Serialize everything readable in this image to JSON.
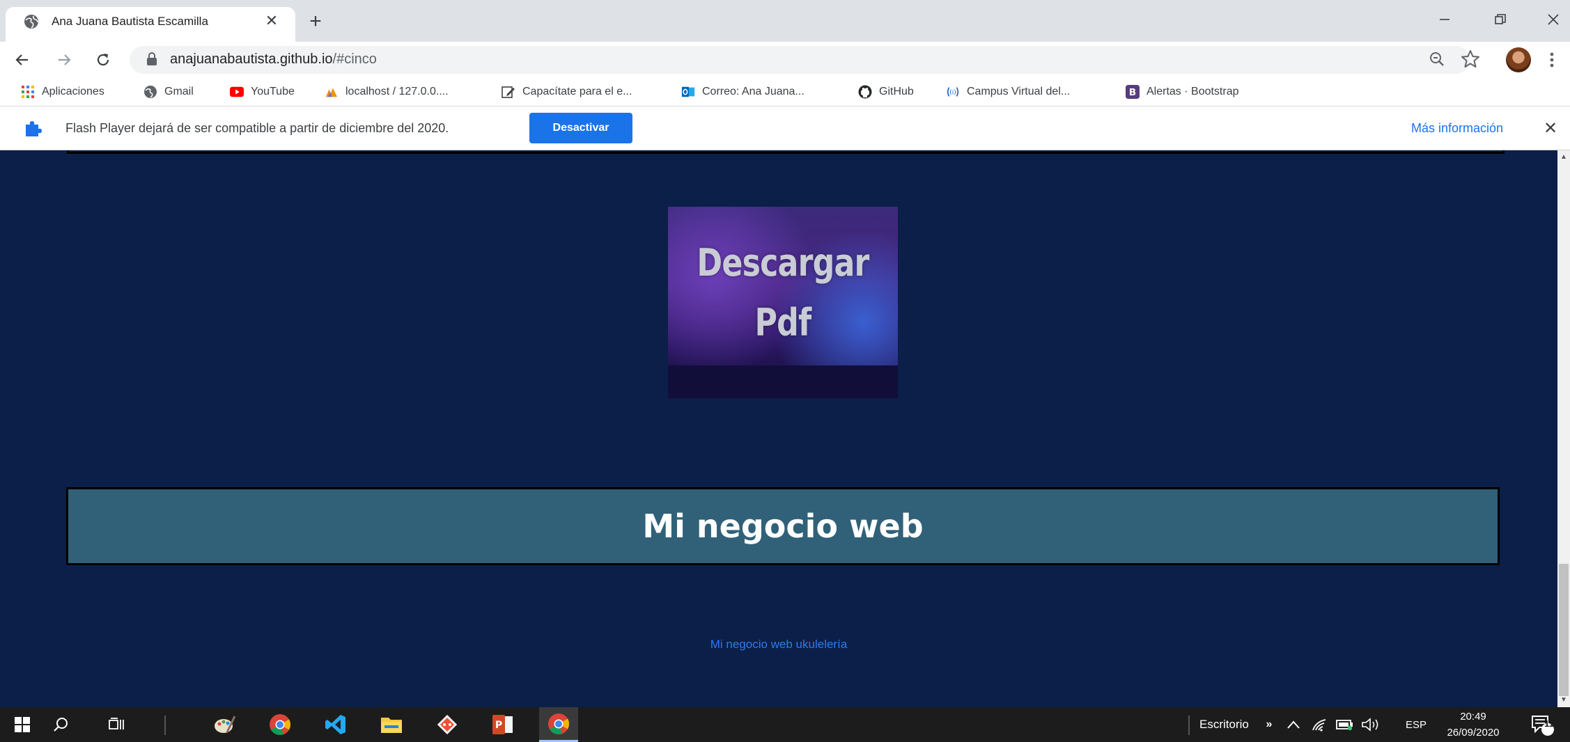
{
  "browser": {
    "tab_title": "Ana Juana Bautista Escamilla",
    "tab_close": "✕",
    "new_tab": "+",
    "url_host": "anajuanabautista.github.io",
    "url_path": "/#cinco"
  },
  "bookmarks": [
    {
      "label": "Aplicaciones",
      "icon": "apps-grid-icon"
    },
    {
      "label": "Gmail",
      "icon": "globe-icon"
    },
    {
      "label": "YouTube",
      "icon": "youtube-icon"
    },
    {
      "label": "localhost / 127.0.0....",
      "icon": "phpmyadmin-icon"
    },
    {
      "label": "Capacítate para el e...",
      "icon": "edit-doc-icon"
    },
    {
      "label": "Correo: Ana Juana...",
      "icon": "outlook-icon"
    },
    {
      "label": "GitHub",
      "icon": "github-icon"
    },
    {
      "label": "Campus Virtual del...",
      "icon": "broadcast-icon"
    },
    {
      "label": "Alertas · Bootstrap",
      "icon": "bootstrap-icon"
    }
  ],
  "infobar": {
    "message": "Flash Player dejará de ser compatible a partir de diciembre del 2020.",
    "button": "Desactivar",
    "more_info": "Más información",
    "close": "✕"
  },
  "page": {
    "pdf_line1": "Descargar",
    "pdf_line2": "Pdf",
    "business_title": "Mi negocio web",
    "ukulele_link": "Mi negocio web ukulelería"
  },
  "taskbar": {
    "desktop_label": "Escritorio",
    "language": "ESP",
    "time": "20:49",
    "date": "26/09/2020",
    "notification_count": "11"
  },
  "colors": {
    "page_bg": "#0b1f48",
    "banner_bg": "#306179",
    "accent_blue": "#1a73e8",
    "link_blue": "#2b7bf0"
  }
}
